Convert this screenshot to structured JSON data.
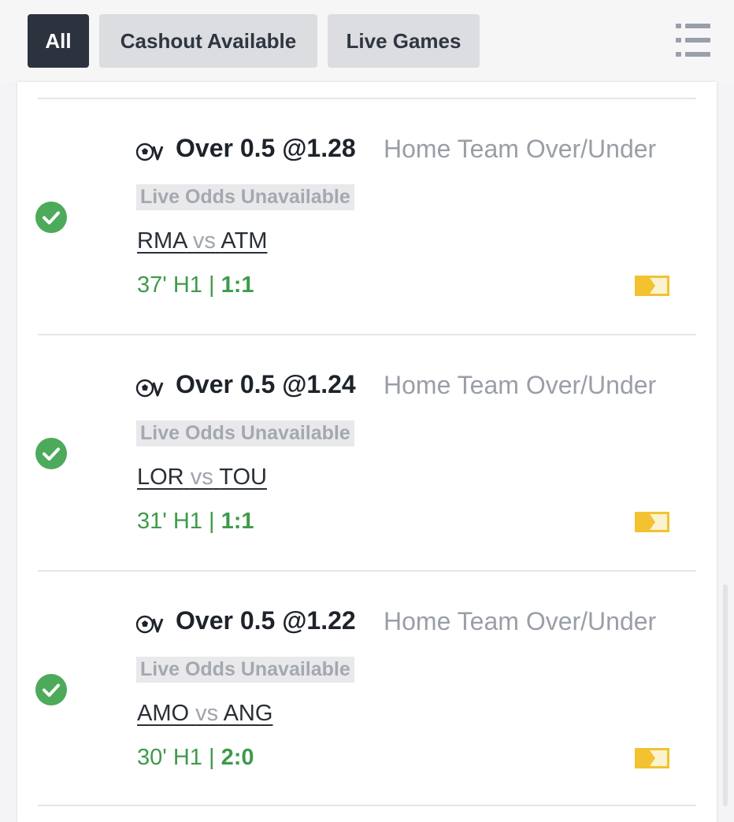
{
  "filters": {
    "all": "All",
    "cashout": "Cashout Available",
    "live": "Live Games"
  },
  "bets": [
    {
      "selection": "Over 0.5 @1.28",
      "market": "Home Team Over/Under",
      "badge": "Live Odds Unavailable",
      "home": "RMA",
      "vs": "vs",
      "away": "ATM",
      "time": "37' H1 | ",
      "score": "1:1"
    },
    {
      "selection": "Over 0.5 @1.24",
      "market": "Home Team Over/Under",
      "badge": "Live Odds Unavailable",
      "home": "LOR",
      "vs": "vs",
      "away": "TOU",
      "time": "31' H1 | ",
      "score": "1:1"
    },
    {
      "selection": "Over 0.5 @1.22",
      "market": "Home Team Over/Under",
      "badge": "Live Odds Unavailable",
      "home": "AMO",
      "vs": "vs",
      "away": "ANG",
      "time": "30' H1 | ",
      "score": "2:0"
    }
  ],
  "colors": {
    "active_chip": "#2d333e",
    "win_green": "#4caa5a",
    "status_green": "#3f9a4b",
    "tag_yellow": "#f2c230"
  },
  "icons": [
    "soccer-virtual-icon",
    "check-circle-icon",
    "ticket-tag-icon",
    "list-menu-icon"
  ]
}
